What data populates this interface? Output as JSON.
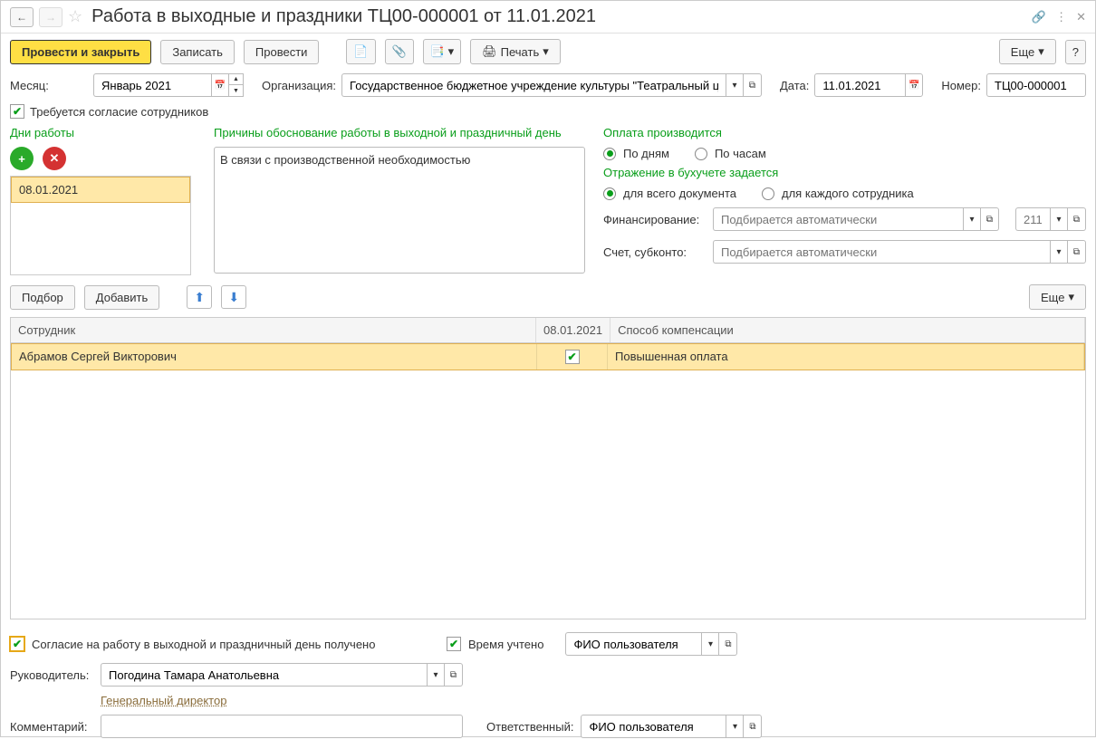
{
  "titlebar": {
    "title": "Работа в выходные и праздники ТЦ00-000001 от 11.01.2021"
  },
  "toolbar": {
    "post_close": "Провести и закрыть",
    "save": "Записать",
    "post": "Провести",
    "print": "Печать",
    "more": "Еще"
  },
  "fields": {
    "month_label": "Месяц:",
    "month_value": "Январь 2021",
    "org_label": "Организация:",
    "org_value": "Государственное бюджетное учреждение культуры \"Театральный це",
    "date_label": "Дата:",
    "date_value": "11.01.2021",
    "number_label": "Номер:",
    "number_value": "ТЦ00-000001",
    "consent_required": "Требуется согласие сотрудников"
  },
  "workdays": {
    "label": "Дни работы",
    "items": [
      "08.01.2021"
    ]
  },
  "reason": {
    "label": "Причины обоснование работы в выходной и праздничный день",
    "text": "В связи с производственной необходимостью"
  },
  "payment": {
    "header": "Оплата производится",
    "by_days": "По дням",
    "by_hours": "По часам",
    "accounting_header": "Отражение в бухучете задается",
    "for_doc": "для всего документа",
    "for_each": "для каждого сотрудника",
    "financing_label": "Финансирование:",
    "financing_placeholder": "Подбирается автоматически",
    "code_value": "211",
    "account_label": "Счет, субконто:",
    "account_placeholder": "Подбирается автоматически"
  },
  "employees_toolbar": {
    "select": "Подбор",
    "add": "Добавить",
    "more": "Еще"
  },
  "table": {
    "headers": {
      "employee": "Сотрудник",
      "date": "08.01.2021",
      "compensation": "Способ компенсации"
    },
    "rows": [
      {
        "employee": "Абрамов Сергей Викторович",
        "checked": true,
        "compensation": "Повышенная оплата"
      }
    ]
  },
  "footer": {
    "consent_received": "Согласие на работу в выходной и праздничный день получено",
    "time_accounted": "Время учтено",
    "user_fio": "ФИО пользователя",
    "manager_label": "Руководитель:",
    "manager_value": "Погодина Тамара Анатольевна",
    "manager_position": "Генеральный директор",
    "comment_label": "Комментарий:",
    "comment_value": "",
    "responsible_label": "Ответственный:",
    "responsible_value": "ФИО пользователя"
  }
}
